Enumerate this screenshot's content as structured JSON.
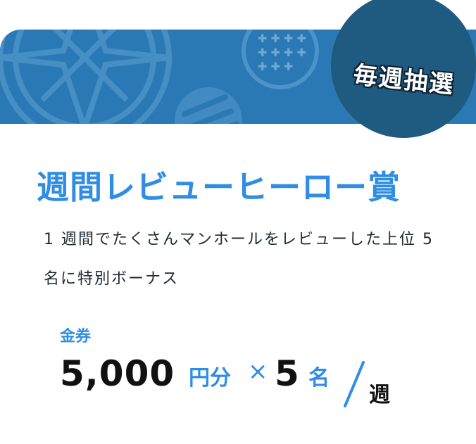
{
  "banner": {
    "badge_text": "毎週抽選",
    "colors": {
      "banner": "#2b79b4",
      "badge": "#1f5a80"
    }
  },
  "award": {
    "title": "週間レビューヒーロー賞",
    "description": "1 週間でたくさんマンホールをレビューした上位 5 名に特別ボーナス"
  },
  "prize": {
    "label": "金券",
    "amount": "5,000",
    "unit": "円分",
    "times": "×",
    "count": "5",
    "count_unit": "名",
    "period": "週"
  }
}
